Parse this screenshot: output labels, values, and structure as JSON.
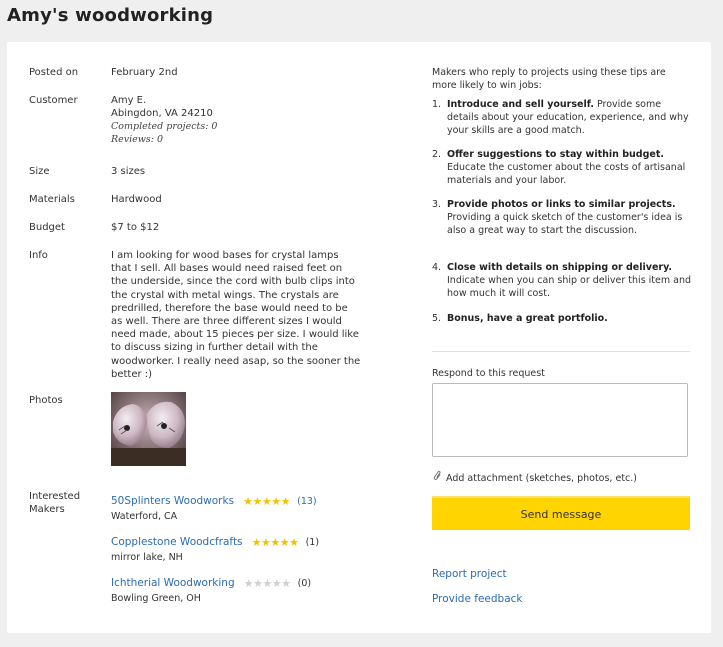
{
  "page": {
    "title": "Amy's woodworking"
  },
  "details": {
    "posted_on": {
      "label": "Posted on",
      "value": "February 2nd"
    },
    "customer": {
      "label": "Customer",
      "name": "Amy E.",
      "location": "Abingdon, VA 24210",
      "completed_projects": "Completed projects: 0",
      "reviews": "Reviews: 0"
    },
    "size": {
      "label": "Size",
      "value": "3 sizes"
    },
    "materials": {
      "label": "Materials",
      "value": "Hardwood"
    },
    "budget": {
      "label": "Budget",
      "value": "$7 to $12"
    },
    "info": {
      "label": "Info",
      "value": "I am looking for wood bases for crystal lamps that I sell. All bases would need raised feet on the underside, since the cord with bulb clips into the crystal with metal wings. The crystals are predrilled, therefore the base would need to be as well. There are three different sizes I would need made, about 15 pieces per size. I would like to discuss sizing in further detail with the woodworker. I really need asap, so the sooner the better :)"
    },
    "photos": {
      "label": "Photos"
    },
    "makers_label": "Interested Makers"
  },
  "makers": [
    {
      "name": "50Splinters Woodworks",
      "location": "Waterford, CA",
      "rating": 5,
      "count": "(13)",
      "count_link": true
    },
    {
      "name": "Copplestone Woodcfrafts",
      "location": "mirror lake, NH",
      "rating": 5,
      "count": "(1)",
      "count_link": false
    },
    {
      "name": "Ichtherial Woodworking",
      "location": "Bowling Green, OH",
      "rating": 0,
      "count": "(0)",
      "count_link": false
    }
  ],
  "tips": {
    "heading": "Makers who reply to projects using these tips are more likely to win jobs:",
    "items": [
      {
        "num": "1.",
        "bold": "Introduce and sell yourself.",
        "text": " Provide some details about your education, experience, and why your skills are a good match."
      },
      {
        "num": "2.",
        "bold": "Offer suggestions to stay within budget.",
        "text": " Educate the customer about the costs of artisanal materials and your labor."
      },
      {
        "num": "3.",
        "bold": "Provide photos or links to similar projects.",
        "text": " Providing a quick sketch of the customer's idea is also a great way to start the discussion."
      },
      {
        "num": "4.",
        "bold": "Close with details on shipping or delivery.",
        "text": " Indicate when you can ship or deliver this item and how much it will cost."
      },
      {
        "num": "5.",
        "bold": "Bonus, have a great portfolio.",
        "text": ""
      }
    ]
  },
  "respond": {
    "label": "Respond to this request",
    "message_value": "",
    "attach_label": "Add attachment (sketches, photos, etc.)",
    "send_label": "Send message"
  },
  "links": {
    "report": "Report project",
    "feedback": "Provide feedback"
  },
  "colors": {
    "accent": "#ffd400",
    "link": "#2b6cb0",
    "star": "#f2c200"
  }
}
